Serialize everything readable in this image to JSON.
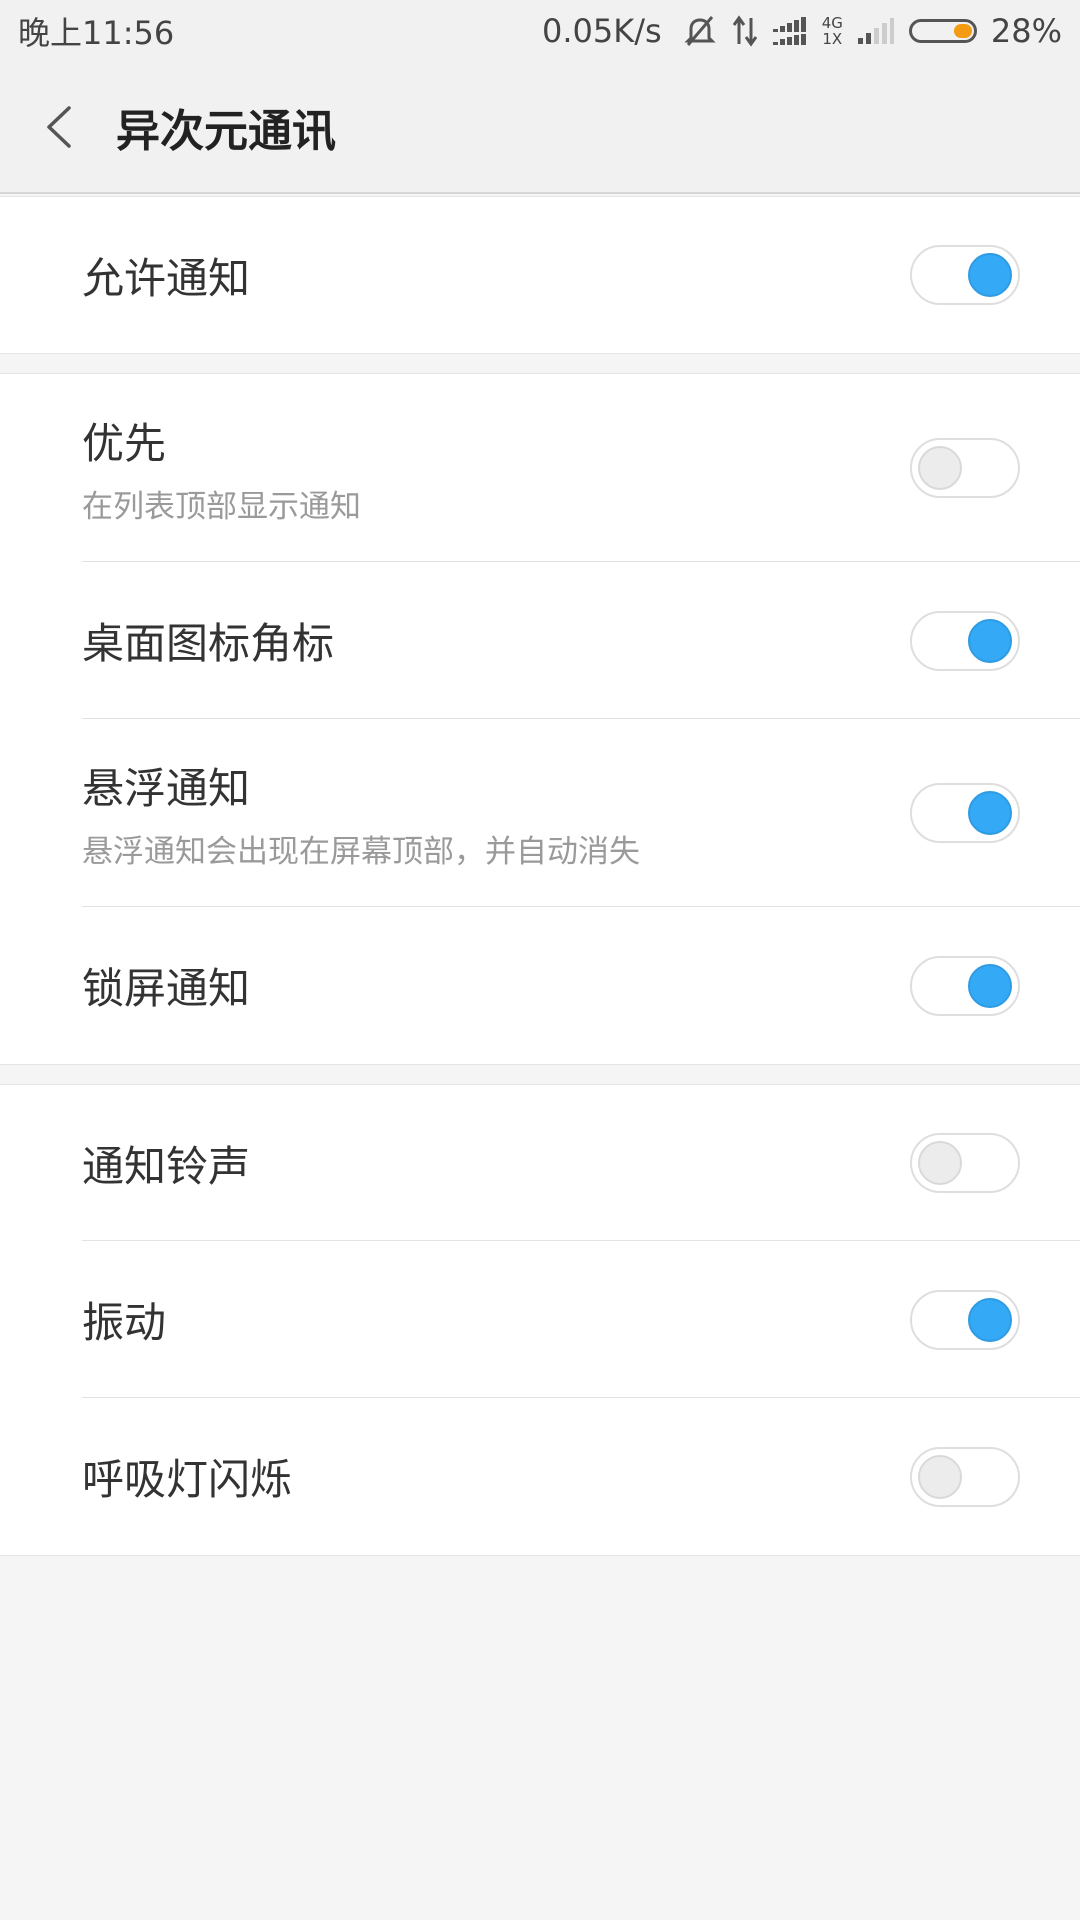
{
  "status_bar": {
    "time": "晚上11:56",
    "net_speed": "0.05K/s",
    "network_top": "4G",
    "network_bottom": "1X",
    "battery": "28%",
    "battery_color": "#f39c12",
    "icons": [
      "mute-icon",
      "data-arrows-icon",
      "signal-icon",
      "signal-weak-icon",
      "battery-icon"
    ]
  },
  "header": {
    "title": "异次元通讯",
    "back_icon": "chevron-left-icon"
  },
  "accent_color": "#34a9f5",
  "sections": [
    {
      "items": [
        {
          "label": "允许通知",
          "sub": "",
          "on": true
        }
      ]
    },
    {
      "items": [
        {
          "label": "优先",
          "sub": "在列表顶部显示通知",
          "on": false
        },
        {
          "label": "桌面图标角标",
          "sub": "",
          "on": true
        },
        {
          "label": "悬浮通知",
          "sub": "悬浮通知会出现在屏幕顶部，并自动消失",
          "on": true
        },
        {
          "label": "锁屏通知",
          "sub": "",
          "on": true
        }
      ]
    },
    {
      "items": [
        {
          "label": "通知铃声",
          "sub": "",
          "on": false
        },
        {
          "label": "振动",
          "sub": "",
          "on": true
        },
        {
          "label": "呼吸灯闪烁",
          "sub": "",
          "on": false
        }
      ]
    }
  ]
}
